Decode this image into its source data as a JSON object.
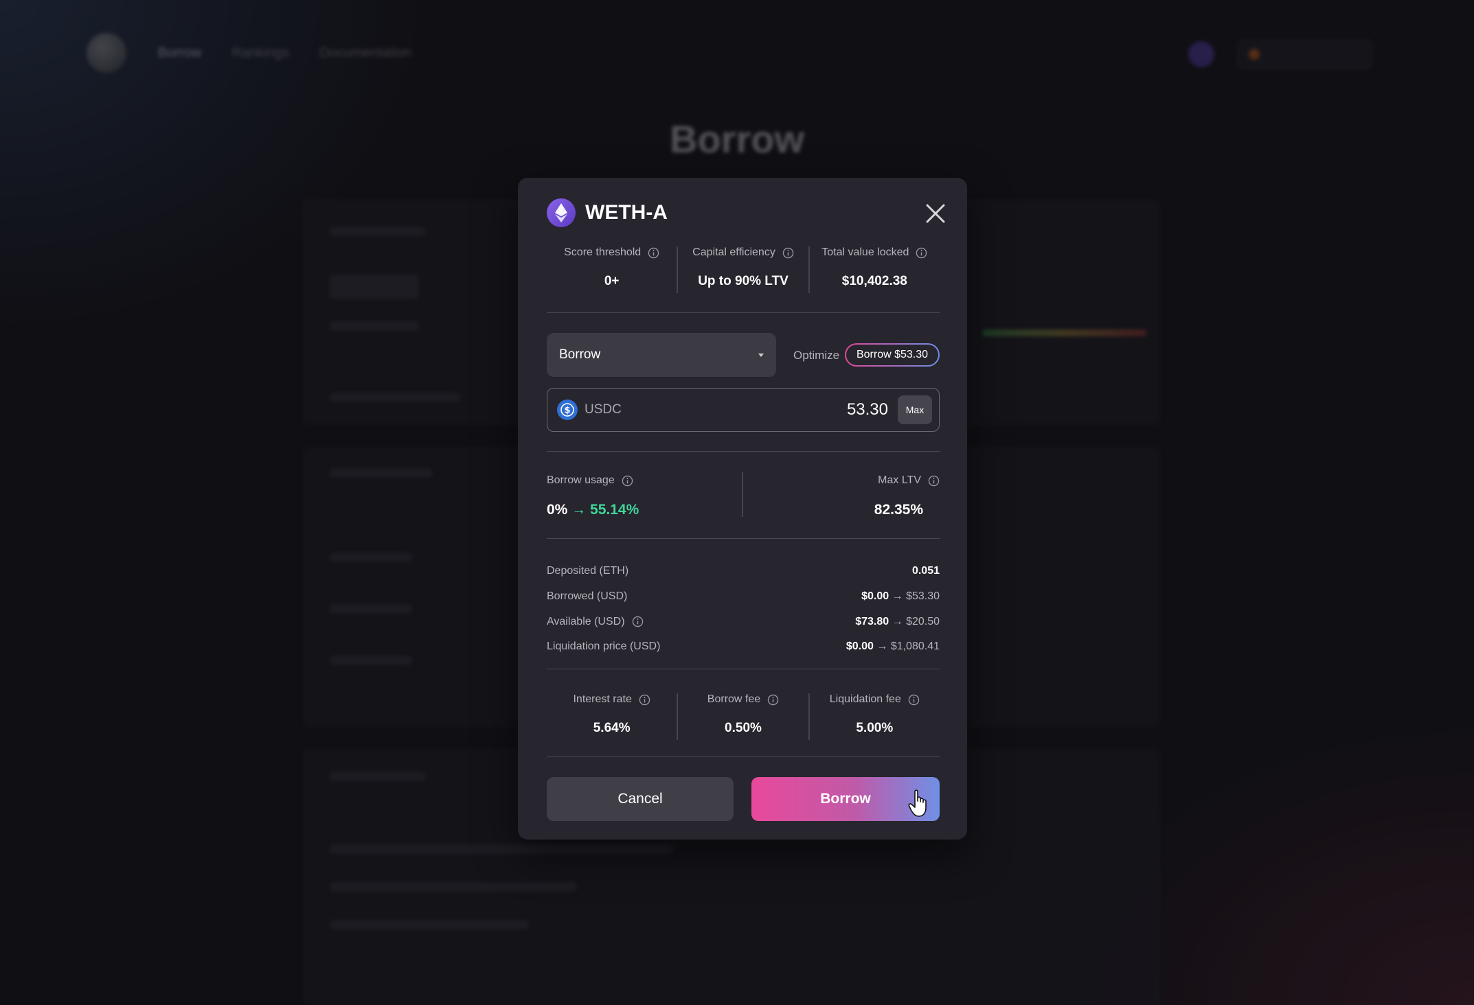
{
  "background": {
    "nav": {
      "links": [
        "Borrow",
        "Rankings",
        "Documentation"
      ]
    },
    "page_title": "Borrow"
  },
  "modal": {
    "title": "WETH-A",
    "stats": [
      {
        "label": "Score threshold",
        "value": "0+"
      },
      {
        "label": "Capital efficiency",
        "value": "Up to 90% LTV"
      },
      {
        "label": "Total value locked",
        "value": "$10,402.38"
      }
    ],
    "action_select": "Borrow",
    "optimize": {
      "label": "Optimize",
      "chip": "Borrow $53.30"
    },
    "amount": {
      "token": "USDC",
      "value": "53.30",
      "max_label": "Max"
    },
    "usage": {
      "label": "Borrow usage",
      "from": "0%",
      "to": "55.14%",
      "max_ltv_label": "Max LTV",
      "max_ltv_value": "82.35%"
    },
    "details": [
      {
        "label": "Deposited (ETH)",
        "from": "0.051",
        "to": ""
      },
      {
        "label": "Borrowed (USD)",
        "from": "$0.00",
        "to": "$53.30"
      },
      {
        "label": "Available (USD)",
        "from": "$73.80",
        "to": "$20.50"
      },
      {
        "label": "Liquidation price (USD)",
        "from": "$0.00",
        "to": "$1,080.41"
      }
    ],
    "fees": [
      {
        "label": "Interest rate",
        "value": "5.64%"
      },
      {
        "label": "Borrow fee",
        "value": "0.50%"
      },
      {
        "label": "Liquidation fee",
        "value": "5.00%"
      }
    ],
    "cancel_label": "Cancel",
    "borrow_label": "Borrow"
  },
  "colors": {
    "accent_pink": "#e8499a",
    "accent_blue": "#6f90e6",
    "positive": "#3fd69a"
  }
}
